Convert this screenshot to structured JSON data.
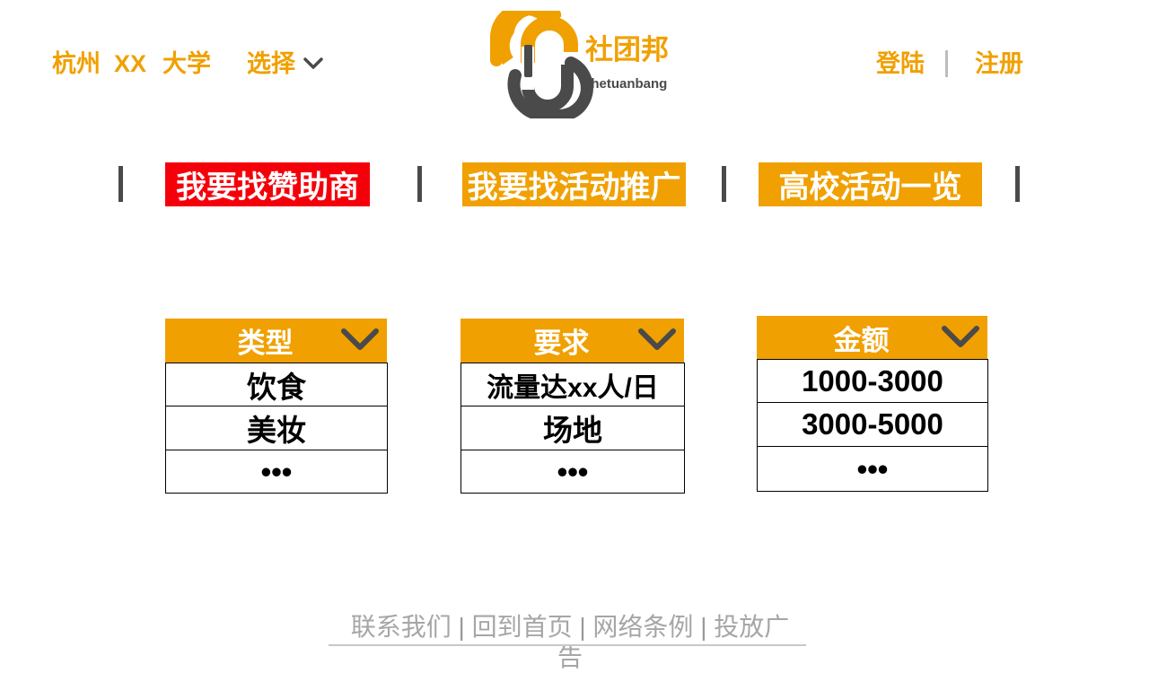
{
  "header": {
    "location": {
      "city": "杭州",
      "school_name": "XX",
      "school_type": "大学"
    },
    "select_label": "选择",
    "brand": {
      "name_cn": "社团邦",
      "name_en": "shetuanbang"
    },
    "login_label": "登陆",
    "register_label": "注册",
    "separator": "|"
  },
  "nav": {
    "tabs": [
      {
        "label": "我要找赞助商",
        "active": true
      },
      {
        "label": "我要找活动推广",
        "active": false
      },
      {
        "label": "高校活动一览",
        "active": false
      }
    ]
  },
  "filters": [
    {
      "title": "类型",
      "options": [
        "饮食",
        "美妆",
        "•••"
      ]
    },
    {
      "title": "要求",
      "options": [
        "流量达xx人/日",
        "场地",
        "•••"
      ]
    },
    {
      "title": "金额",
      "options": [
        "1000-3000",
        "3000-5000",
        "•••"
      ]
    }
  ],
  "footer": {
    "links": [
      "联系我们",
      "回到首页",
      "网络条例",
      "投放广告"
    ],
    "separator": "|"
  },
  "colors": {
    "accent": "#f0a000",
    "active_tab": "#f5000a",
    "dark": "#4a4a4a",
    "footer_text": "#a6a6a6"
  },
  "icons": {
    "select_chevron": "chevron-down-icon",
    "filter_chevron": "chevron-down-icon",
    "logo": "linked-rings-logo"
  }
}
